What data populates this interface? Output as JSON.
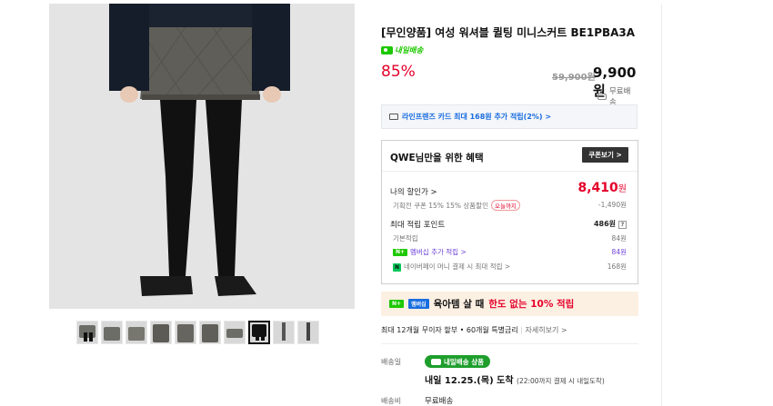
{
  "product": {
    "title": "[무인양품] 여성 워셔블 퀼팅 미니스커트 BE1PBA3A",
    "delivery_badge": "내일배송",
    "discount": "85%",
    "original_price": "59,900원",
    "price": "9,900원",
    "shipping": "무료배송"
  },
  "card_promo": "라인프렌즈 카드 최대 168원 추가 적립(2%) >",
  "benefit": {
    "heading": "QWE님만을 위한 혜택",
    "coupon_button": "쿠폰보기 >",
    "my_price_label": "나의 할인가 >",
    "my_price_value": "8,410",
    "my_price_unit": "원",
    "coupon_detail": "기획전 쿠폰 15% 15% 상품할인",
    "coupon_today": "오늘까지",
    "coupon_amount": "-1,490원",
    "points_label": "최대 적립 포인트",
    "points_value": "486원",
    "help": "?",
    "base_label": "기본적립",
    "base_value": "84원",
    "membership_label": "멤버십 추가 적립 >",
    "membership_value": "84원",
    "npay_label": "네이버페이 머니 결제 시 최대 적립 >",
    "npay_value": "168원",
    "nplus_tag": "N+",
    "npay_tag": "N"
  },
  "promo": {
    "badge1": "N+",
    "badge2": "멤버십",
    "text1": "육아템 살 때",
    "text2": "한도 없는 10% 적립"
  },
  "installment": {
    "text": "최대 12개월 무이자 할부 • 60개월 특별금리",
    "more": "자세히보기 >"
  },
  "delivery": {
    "label": "배송일",
    "badge": "내일배송 상품",
    "arrive": "내일 12.25.(목) 도착",
    "arrive_note": "(22:00까지 결제 시 내일도착)",
    "fee_label": "배송비",
    "fee": "무료배송"
  },
  "thumbnails": [
    {
      "name": "thumb-1"
    },
    {
      "name": "thumb-2"
    },
    {
      "name": "thumb-3"
    },
    {
      "name": "thumb-4"
    },
    {
      "name": "thumb-5"
    },
    {
      "name": "thumb-6"
    },
    {
      "name": "thumb-7"
    },
    {
      "name": "thumb-8"
    },
    {
      "name": "thumb-9"
    },
    {
      "name": "thumb-10"
    }
  ],
  "colors": {
    "accent_red": "#e4012a",
    "naver_green": "#1ec800",
    "link_blue": "#1a6de0"
  }
}
